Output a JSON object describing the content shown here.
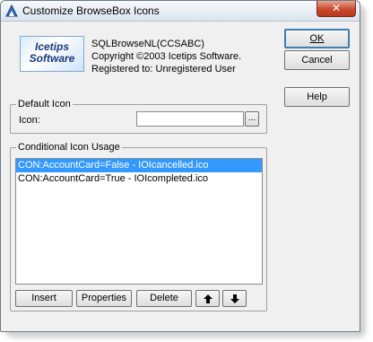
{
  "window": {
    "title": "Customize BrowseBox Icons",
    "close_label": "✕"
  },
  "product": {
    "logo_line1": "Icetips",
    "logo_line2": "Software",
    "name": "SQLBrowseNL(CCSABC)",
    "copyright": "Copyright ©2003 Icetips Software.",
    "registration": "Registered to: Unregistered User"
  },
  "buttons": {
    "ok": "OK",
    "cancel": "Cancel",
    "help": "Help",
    "ellipsis": "..."
  },
  "default_icon": {
    "group_label": "Default Icon",
    "icon_label": "Icon:",
    "icon_value": ""
  },
  "conditional": {
    "group_label": "Conditional Icon Usage",
    "items": [
      {
        "text": "CON:AccountCard=False - IOIcancelled.ico",
        "selected": true
      },
      {
        "text": "CON:AccountCard=True - IOIcompleted.ico",
        "selected": false
      }
    ],
    "insert": "Insert",
    "properties": "Properties",
    "delete": "Delete",
    "up": "🡅",
    "down": "🡇"
  },
  "colors": {
    "selection": "#3399ff",
    "close": "#c84a2e"
  }
}
